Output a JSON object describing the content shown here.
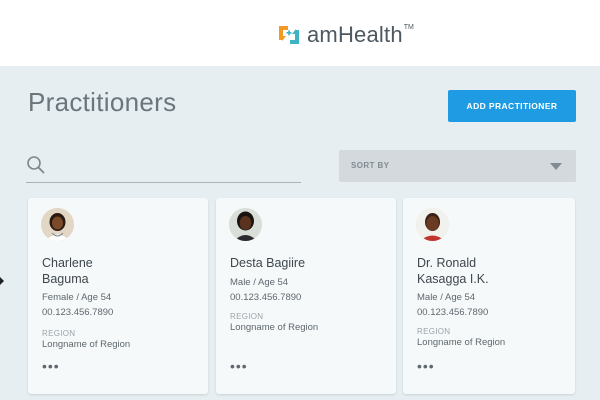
{
  "brand": {
    "name": "amHealth",
    "trademark": "TM",
    "colors": {
      "orange": "#f29a22",
      "teal": "#3db3c4"
    }
  },
  "page": {
    "title": "Practitioners",
    "add_button_label": "ADD PRACTITIONER"
  },
  "search": {
    "icon": "search-icon",
    "value": "",
    "placeholder": ""
  },
  "sort": {
    "label": "SORT BY",
    "icon": "chevron-down-icon"
  },
  "practitioners": [
    {
      "name_line1": "Charlene",
      "name_line2": "Baguma",
      "gender_age": "Female / Age 54",
      "phone": "00.123.456.7890",
      "region_label": "REGION",
      "region": "Longname of Region",
      "more": "•••"
    },
    {
      "name_line1": "Desta Bagiire",
      "name_line2": "",
      "gender_age": "Male / Age 54",
      "phone": "00.123.456.7890",
      "region_label": "REGION",
      "region": "Longname of Region",
      "more": "•••"
    },
    {
      "name_line1": "Dr. Ronald",
      "name_line2": "Kasagga I.K.",
      "gender_age": "Male / Age 54",
      "phone": "00.123.456.7890",
      "region_label": "REGION",
      "region": "Longname of Region",
      "more": "•••"
    }
  ],
  "accent_color": "#1e9be2"
}
